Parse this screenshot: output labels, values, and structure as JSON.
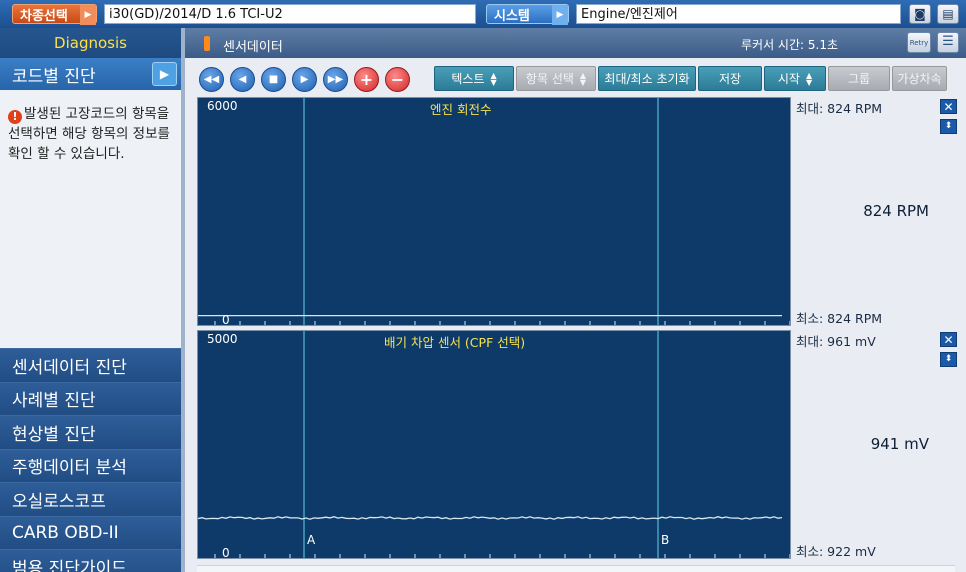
{
  "topbar": {
    "vehicle_button": "차종선택",
    "vehicle_value": "i30(GD)/2014/D 1.6 TCI-U2",
    "system_button": "시스템",
    "system_value": "Engine/엔진제어"
  },
  "sidebar": {
    "header": "Diagnosis",
    "active_item": "코드별 진단",
    "info_text": "발생된 고장코드의 항목을 선택하면 해당 항목의 정보를 확인 할 수 있습니다.",
    "items": [
      {
        "label": "센서데이터 진단"
      },
      {
        "label": "사례별 진단"
      },
      {
        "label": "현상별 진단"
      },
      {
        "label": "주행데이터 분석"
      },
      {
        "label": "오실로스코프"
      },
      {
        "label": "CARB OBD-II"
      },
      {
        "label": "범용 진단가이드"
      }
    ]
  },
  "main": {
    "title": "센서데이터",
    "cursor_time": "루커서 시간: 5.1초",
    "retry_label": "Retry"
  },
  "toolbar": {
    "text_label": "텍스트",
    "item_select_label": "항목 선택",
    "reset_label": "최대/최소 초기화",
    "save_label": "저장",
    "start_label": "시작",
    "group_label": "그룹",
    "virtual_label": "가상차속"
  },
  "graphs": [
    {
      "title": "엔진 회전수",
      "max": "6000",
      "min": "0",
      "level": 0.044,
      "noise": 0,
      "readout_max": "최대:   824 RPM",
      "readout_min": "최소:   824 RPM",
      "current_value": "824 RPM"
    },
    {
      "title": "배기 차압 센서 (CPF 선택)",
      "max": "5000",
      "min": "0",
      "level": 0.188,
      "noise": 0.003,
      "readout_max": "최대:   961 mV",
      "readout_min": "최소:   922 mV",
      "current_value": "941 mV",
      "cursor_a": "A",
      "cursor_b": "B"
    }
  ],
  "colors": {
    "graph_bg": "#0e3a6a",
    "trace": "#d8e6f2",
    "cursor": "#5fd4ea",
    "title": "#f5e24c"
  }
}
